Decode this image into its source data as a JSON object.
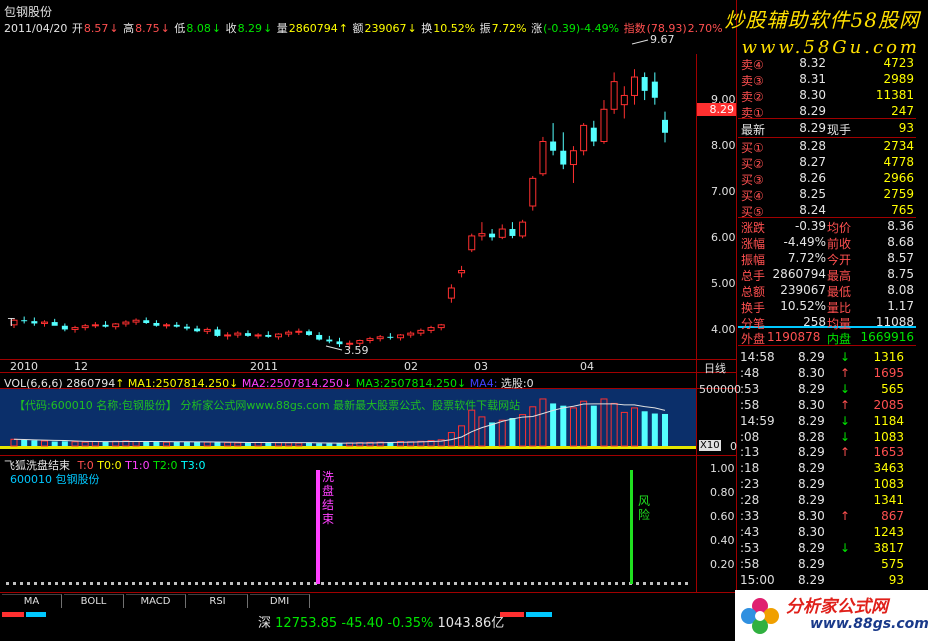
{
  "stock": {
    "name": "包钢股份",
    "date": "2011/04/20",
    "open_label": "开",
    "open": "8.57",
    "high_label": "高",
    "high": "8.75",
    "low_label": "低",
    "low": "8.08",
    "close_label": "收",
    "close": "8.29",
    "volume_label": "量",
    "volume": "2860794",
    "amount_label": "额",
    "amount": "239067",
    "turnover_label": "换",
    "turnover": "10.52%",
    "amplitude_label": "振",
    "amplitude": "7.72%",
    "change_label": "涨",
    "change": "(-0.39)-4.49%",
    "index_label": "指数",
    "index_value": "(78.93)",
    "index_pct": "2.70%"
  },
  "watermark": {
    "line1": "炒股辅助软件58股网",
    "line2": "www.58Gu.com"
  },
  "price_axis": [
    "9.00",
    "8.00",
    "7.00",
    "6.00",
    "5.00",
    "4.00"
  ],
  "current_price_tag": "8.29",
  "annotations": {
    "high_peak": "9.67",
    "low_trough": "3.59",
    "t_marker": "T"
  },
  "time_axis": [
    "2010",
    "12",
    "2011",
    "02",
    "03",
    "04"
  ],
  "period_label": "日线",
  "volume_header": {
    "vol_label": "VOL(6,6,6)",
    "vol": "2860794",
    "ma1": "MA1:2507814.250",
    "ma2": "MA2:2507814.250",
    "ma3": "MA3:2507814.250",
    "ma4": "MA4:",
    "selector": "选股:0"
  },
  "volume_axis": {
    "top": "500000",
    "x10": "X10",
    "zero": "0"
  },
  "volume_banner": "【代码:600010 名称:包钢股份】    分析家公式网www.88gs.com 最新最大股票公式、股票软件下载网站",
  "indicator": {
    "title": "飞狐洗盘结束",
    "params": [
      "T:0",
      "T0:0",
      "T1:0",
      "T2:0",
      "T3:0"
    ],
    "subtitle": "600010 包钢股份",
    "signal1": "洗盘结束",
    "signal2": "风险",
    "axis": [
      "1.00",
      "0.80",
      "0.60",
      "0.40",
      "0.20"
    ]
  },
  "order_book": {
    "sells": [
      {
        "label": "卖④",
        "price": "8.32",
        "vol": "4723"
      },
      {
        "label": "卖③",
        "price": "8.31",
        "vol": "2989"
      },
      {
        "label": "卖②",
        "price": "8.30",
        "vol": "11381"
      },
      {
        "label": "卖①",
        "price": "8.29",
        "vol": "247"
      }
    ],
    "latest": {
      "label": "最新",
      "price": "8.29",
      "label2": "现手",
      "vol": "93"
    },
    "buys": [
      {
        "label": "买①",
        "price": "8.28",
        "vol": "2734"
      },
      {
        "label": "买②",
        "price": "8.27",
        "vol": "4778"
      },
      {
        "label": "买③",
        "price": "8.26",
        "vol": "2966"
      },
      {
        "label": "买④",
        "price": "8.25",
        "vol": "2759"
      },
      {
        "label": "买⑤",
        "price": "8.24",
        "vol": "765"
      }
    ]
  },
  "stats": [
    {
      "l1": "涨跌",
      "v1": "-0.39",
      "l2": "均价",
      "v2": "8.36"
    },
    {
      "l1": "涨幅",
      "v1": "-4.49%",
      "l2": "前收",
      "v2": "8.68"
    },
    {
      "l1": "振幅",
      "v1": "7.72%",
      "l2": "今开",
      "v2": "8.57"
    },
    {
      "l1": "总手",
      "v1": "2860794",
      "l2": "最高",
      "v2": "8.75"
    },
    {
      "l1": "总额",
      "v1": "239067",
      "l2": "最低",
      "v2": "8.08"
    },
    {
      "l1": "换手",
      "v1": "10.52%",
      "l2": "量比",
      "v2": "1.17"
    },
    {
      "l1": "分笔",
      "v1": "258",
      "l2": "均量",
      "v2": "11088"
    }
  ],
  "outer_inner": {
    "outer_label": "外盘",
    "outer": "1190878",
    "inner_label": "内盘",
    "inner": "1669916"
  },
  "ticks": [
    {
      "time": "14:58",
      "price": "8.29",
      "arrow": "↓",
      "vol": "1316",
      "dir": "down"
    },
    {
      "time": ":48",
      "price": "8.30",
      "arrow": "↑",
      "vol": "1695",
      "dir": "up"
    },
    {
      "time": ":53",
      "price": "8.29",
      "arrow": "↓",
      "vol": "565",
      "dir": "down"
    },
    {
      "time": ":58",
      "price": "8.30",
      "arrow": "↑",
      "vol": "2085",
      "dir": "up"
    },
    {
      "time": "14:59",
      "price": "8.29",
      "arrow": "↓",
      "vol": "1184",
      "dir": "down"
    },
    {
      "time": ":08",
      "price": "8.28",
      "arrow": "↓",
      "vol": "1083",
      "dir": "down"
    },
    {
      "time": ":13",
      "price": "8.29",
      "arrow": "↑",
      "vol": "1653",
      "dir": "up"
    },
    {
      "time": ":18",
      "price": "8.29",
      "arrow": "",
      "vol": "3463",
      "dir": "flat"
    },
    {
      "time": ":23",
      "price": "8.29",
      "arrow": "",
      "vol": "1083",
      "dir": "flat"
    },
    {
      "time": ":28",
      "price": "8.29",
      "arrow": "",
      "vol": "1341",
      "dir": "flat"
    },
    {
      "time": ":33",
      "price": "8.30",
      "arrow": "↑",
      "vol": "867",
      "dir": "up"
    },
    {
      "time": ":43",
      "price": "8.30",
      "arrow": "",
      "vol": "1243",
      "dir": "flat"
    },
    {
      "time": ":53",
      "price": "8.29",
      "arrow": "↓",
      "vol": "3817",
      "dir": "down"
    },
    {
      "time": ":58",
      "price": "8.29",
      "arrow": "",
      "vol": "575",
      "dir": "flat"
    },
    {
      "time": "15:00",
      "price": "8.29",
      "arrow": "",
      "vol": "93",
      "dir": "flat"
    }
  ],
  "tabs": [
    "MA",
    "BOLL",
    "MACD",
    "RSI",
    "DMI"
  ],
  "index_bar": {
    "name": "深",
    "value": "12753.85",
    "change": "-45.40",
    "pct": "-0.35%",
    "amount": "1043.86亿"
  },
  "logo": {
    "text": "分析家公式网",
    "url": "www.88gs.com"
  },
  "chart_data": {
    "type": "candlestick",
    "description_axis": "price",
    "ylim": [
      3.4,
      10.0
    ],
    "candles": [
      [
        4.12,
        4.25,
        4.05,
        4.22
      ],
      [
        4.22,
        4.3,
        4.15,
        4.2
      ],
      [
        4.2,
        4.28,
        4.1,
        4.15
      ],
      [
        4.15,
        4.22,
        4.08,
        4.18
      ],
      [
        4.18,
        4.25,
        4.12,
        4.1
      ],
      [
        4.1,
        4.15,
        3.98,
        4.02
      ],
      [
        4.02,
        4.1,
        3.95,
        4.06
      ],
      [
        4.06,
        4.14,
        4.0,
        4.1
      ],
      [
        4.1,
        4.18,
        4.05,
        4.12
      ],
      [
        4.12,
        4.2,
        4.06,
        4.08
      ],
      [
        4.08,
        4.16,
        4.02,
        4.14
      ],
      [
        4.14,
        4.22,
        4.08,
        4.18
      ],
      [
        4.18,
        4.26,
        4.12,
        4.22
      ],
      [
        4.22,
        4.28,
        4.14,
        4.16
      ],
      [
        4.16,
        4.22,
        4.08,
        4.1
      ],
      [
        4.1,
        4.16,
        4.04,
        4.12
      ],
      [
        4.12,
        4.18,
        4.06,
        4.08
      ],
      [
        4.08,
        4.14,
        4.0,
        4.04
      ],
      [
        4.04,
        4.1,
        3.96,
        3.98
      ],
      [
        3.98,
        4.06,
        3.92,
        4.02
      ],
      [
        4.02,
        4.08,
        3.86,
        3.88
      ],
      [
        3.88,
        3.96,
        3.8,
        3.9
      ],
      [
        3.9,
        3.98,
        3.84,
        3.94
      ],
      [
        3.94,
        4.0,
        3.86,
        3.88
      ],
      [
        3.88,
        3.94,
        3.82,
        3.9
      ],
      [
        3.9,
        3.98,
        3.84,
        3.86
      ],
      [
        3.86,
        3.94,
        3.8,
        3.92
      ],
      [
        3.92,
        4.0,
        3.86,
        3.96
      ],
      [
        3.96,
        4.04,
        3.9,
        3.98
      ],
      [
        3.98,
        4.02,
        3.88,
        3.9
      ],
      [
        3.9,
        3.96,
        3.78,
        3.8
      ],
      [
        3.8,
        3.88,
        3.72,
        3.76
      ],
      [
        3.76,
        3.84,
        3.64,
        3.7
      ],
      [
        3.7,
        3.78,
        3.59,
        3.72
      ],
      [
        3.72,
        3.8,
        3.66,
        3.78
      ],
      [
        3.78,
        3.86,
        3.72,
        3.82
      ],
      [
        3.82,
        3.9,
        3.76,
        3.86
      ],
      [
        3.86,
        3.94,
        3.8,
        3.84
      ],
      [
        3.84,
        3.92,
        3.78,
        3.9
      ],
      [
        3.9,
        3.98,
        3.84,
        3.94
      ],
      [
        3.94,
        4.04,
        3.88,
        4.0
      ],
      [
        4.0,
        4.1,
        3.94,
        4.06
      ],
      [
        4.06,
        4.14,
        4.0,
        4.12
      ],
      [
        4.7,
        5.0,
        4.6,
        4.92
      ],
      [
        5.25,
        5.4,
        5.15,
        5.3
      ],
      [
        5.75,
        6.1,
        5.7,
        6.05
      ],
      [
        6.05,
        6.35,
        5.95,
        6.1
      ],
      [
        6.1,
        6.2,
        5.95,
        6.02
      ],
      [
        6.02,
        6.3,
        5.98,
        6.2
      ],
      [
        6.2,
        6.35,
        6.0,
        6.05
      ],
      [
        6.05,
        6.4,
        6.0,
        6.35
      ],
      [
        6.7,
        7.35,
        6.6,
        7.3
      ],
      [
        7.4,
        8.2,
        7.35,
        8.1
      ],
      [
        8.1,
        8.5,
        7.8,
        7.9
      ],
      [
        7.9,
        8.3,
        7.5,
        7.6
      ],
      [
        7.6,
        8.0,
        7.2,
        7.9
      ],
      [
        7.9,
        8.5,
        7.8,
        8.45
      ],
      [
        8.4,
        8.55,
        8.0,
        8.1
      ],
      [
        8.1,
        9.0,
        8.05,
        8.8
      ],
      [
        8.8,
        9.6,
        8.7,
        9.4
      ],
      [
        8.9,
        9.3,
        8.6,
        9.1
      ],
      [
        9.1,
        9.67,
        8.9,
        9.5
      ],
      [
        9.5,
        9.6,
        9.0,
        9.2
      ],
      [
        9.4,
        9.6,
        8.9,
        9.05
      ],
      [
        8.57,
        8.75,
        8.08,
        8.29
      ]
    ],
    "volume": [
      60,
      55,
      50,
      45,
      40,
      42,
      38,
      35,
      40,
      38,
      42,
      45,
      40,
      38,
      36,
      34,
      38,
      40,
      36,
      34,
      32,
      30,
      28,
      30,
      32,
      34,
      30,
      28,
      26,
      28,
      24,
      22,
      26,
      28,
      30,
      32,
      34,
      36,
      40,
      38,
      42,
      48,
      55,
      120,
      180,
      320,
      260,
      210,
      230,
      250,
      280,
      350,
      420,
      380,
      360,
      340,
      400,
      360,
      420,
      380,
      300,
      340,
      310,
      290,
      286
    ]
  }
}
